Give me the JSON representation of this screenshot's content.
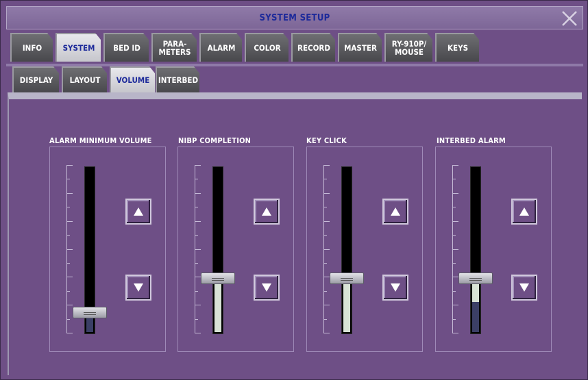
{
  "window": {
    "title": "SYSTEM SETUP"
  },
  "main_tabs": [
    {
      "label": "INFO",
      "active": false
    },
    {
      "label": "SYSTEM",
      "active": true
    },
    {
      "label": "BED ID",
      "active": false
    },
    {
      "label": "PARA-\nMETERS",
      "active": false
    },
    {
      "label": "ALARM",
      "active": false
    },
    {
      "label": "COLOR",
      "active": false
    },
    {
      "label": "RECORD",
      "active": false
    },
    {
      "label": "MASTER",
      "active": false
    },
    {
      "label": "RY-910P/\nMOUSE",
      "active": false
    },
    {
      "label": "KEYS",
      "active": false
    }
  ],
  "sub_tabs": [
    {
      "label": "DISPLAY",
      "active": false
    },
    {
      "label": "LAYOUT",
      "active": false
    },
    {
      "label": "VOLUME",
      "active": true
    },
    {
      "label": "INTERBED",
      "active": false
    }
  ],
  "volume_groups": [
    {
      "label": "ALARM MINIMUM VOLUME",
      "level": 0.125
    },
    {
      "label": "NIBP COMPLETION",
      "level": 0.33
    },
    {
      "label": "KEY CLICK",
      "level": 0.33
    },
    {
      "label": "INTERBED ALARM",
      "level": 0.33
    }
  ],
  "colors": {
    "background": "#6e4f86",
    "title_text": "#1d2a9a",
    "active_tab": "#d6d6dc",
    "inactive_tab": "#5a5a5e",
    "slider_fill": "#d8e3d6"
  }
}
